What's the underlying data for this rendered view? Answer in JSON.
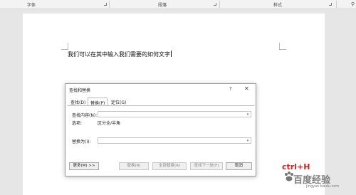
{
  "ribbon": {
    "groups": [
      "字体",
      "段落",
      "样式"
    ],
    "edit_icon": "edit-icon"
  },
  "document": {
    "body_text": "我们可以在其中输入我们需要的如何文字"
  },
  "dialog": {
    "title": "查找和替换",
    "help": "?",
    "close": "✕",
    "tabs": [
      "查找(D)",
      "替换(P)",
      "定位(G)"
    ],
    "active_tab": "替换(P)",
    "find_label": "查找内容(N):",
    "find_value": "",
    "options_label": "选项:",
    "options_value": "区分全/半角",
    "replace_label": "替换为(I):",
    "replace_value": "",
    "buttons": {
      "more": "更多(M) >>",
      "replace": "替换(R)",
      "replace_all": "全部替换(A)",
      "find_next": "查找下一处(F)",
      "cancel": "取消"
    }
  },
  "annotation": {
    "text": "ctrl+H"
  },
  "watermark": {
    "text": "百度经验",
    "sub": "jingyan.baidu.com"
  }
}
